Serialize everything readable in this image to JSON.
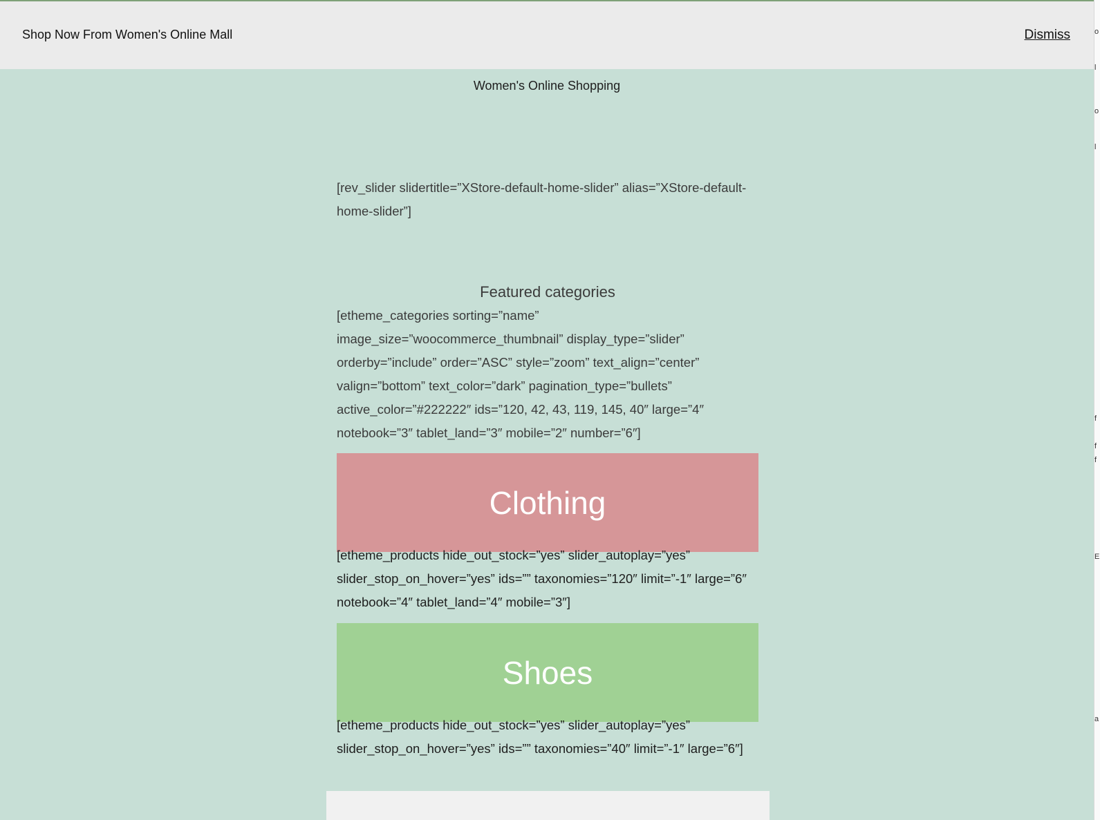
{
  "notice": {
    "text": "Shop Now From Women's Online Mall",
    "dismiss_label": "Dismiss"
  },
  "site": {
    "title": "Women's Online Shopping"
  },
  "main": {
    "rev_slider_shortcode": "[rev_slider slidertitle=”XStore-default-home-slider” alias=”XStore-default-home-slider”]",
    "featured_title": "Featured categories",
    "categories_shortcode": "[etheme_categories sorting=”name” image_size=”woocommerce_thumbnail” display_type=”slider” orderby=”include” order=”ASC” style=”zoom” text_align=”center” valign=”bottom” text_color=”dark” pagination_type=”bullets” active_color=”#222222″ ids=”120, 42, 43, 119, 145, 40″ large=”4″ notebook=”3″ tablet_land=”3″ mobile=”2″ number=”6″]",
    "categories": [
      {
        "label": "Clothing",
        "color": "#d69698",
        "products_shortcode": "[etheme_products hide_out_stock=”yes” slider_autoplay=”yes” slider_stop_on_hover=”yes” ids=”” taxonomies=”120″ limit=”-1″ large=”6″ notebook=”4″ tablet_land=”4″ mobile=”3″]"
      },
      {
        "label": "Shoes",
        "color": "#a0d194",
        "products_shortcode": "[etheme_products hide_out_stock=”yes” slider_autoplay=”yes” slider_stop_on_hover=”yes” ids=”” taxonomies=”40″ limit=”-1″ large=”6″]"
      }
    ]
  },
  "colors": {
    "background": "#c7dfd6",
    "notice_bar": "#ebebeb",
    "top_border": "#7fa178"
  }
}
